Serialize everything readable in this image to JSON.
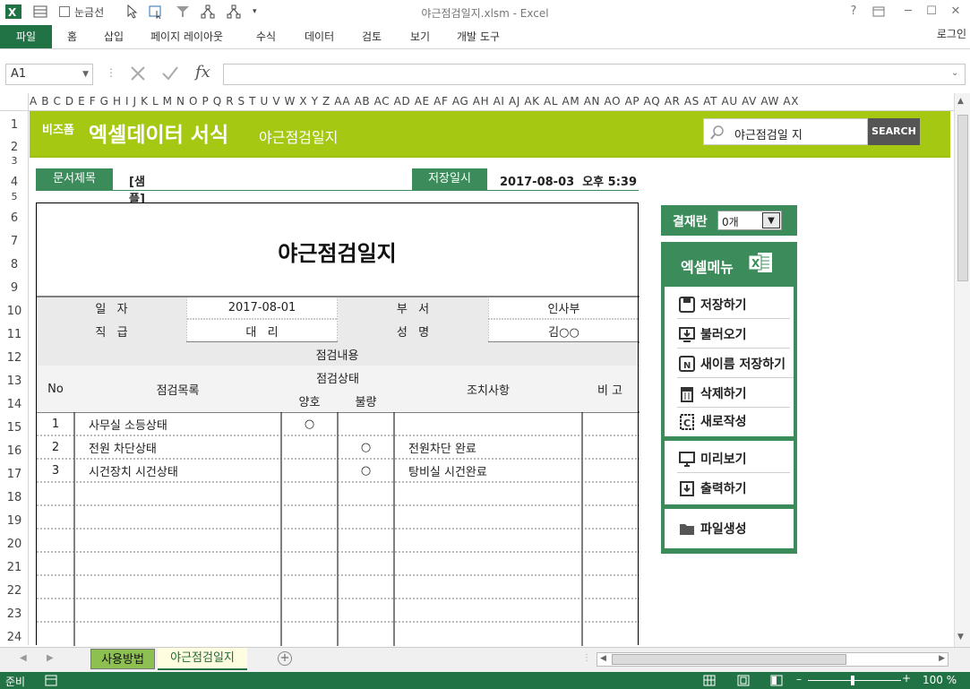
{
  "window": {
    "title": "야근점검일지.xlsm - Excel",
    "gridlines_label": "눈금선",
    "help": "?",
    "min": "─",
    "max": "☐",
    "close": "✕"
  },
  "ribbon": {
    "file": "파일",
    "tabs": [
      "홈",
      "삽입",
      "페이지 레이아웃",
      "수식",
      "데이터",
      "검토",
      "보기",
      "개발 도구"
    ],
    "login": "로그인"
  },
  "formula_bar": {
    "name_box": "A1",
    "fx": "fx",
    "value": ""
  },
  "columns": "A B C D E F G H I J K L M N O P Q R S T U V W X Y Z AA AB AC AD AE AF AG AH AI AJ AK AL AM AN AO AP AQ AR AS AT AU AV AW AX",
  "rows": [
    "1",
    "2",
    "3",
    "4",
    "5",
    "6",
    "7",
    "8",
    "9",
    "10",
    "11",
    "12",
    "13",
    "14",
    "15",
    "16",
    "17",
    "18",
    "19",
    "20",
    "21",
    "22",
    "23",
    "24"
  ],
  "banner": {
    "brand_small": "비즈폼",
    "brand_big": "엑셀데이터 서식",
    "subtitle": "야근점검일지",
    "search_value": "야근점검일 지",
    "search_button": "SEARCH"
  },
  "info": {
    "doc_title_label": "문서제목",
    "doc_title_value": "[샘플] 야근점검일지",
    "saved_label": "저장일시",
    "saved_value": "2017-08-03  오후 5:39"
  },
  "document": {
    "title": "야근점검일지",
    "date_label": "일   자",
    "date_value": "2017-08-01",
    "dept_label": "부   서",
    "dept_value": "인사부",
    "rank_label": "직   급",
    "rank_value": "대   리",
    "name_label": "성   명",
    "name_value": "김○○",
    "section_label": "점검내용",
    "col_no": "No",
    "col_item": "점검목록",
    "col_status": "점검상태",
    "col_good": "양호",
    "col_bad": "불량",
    "col_action": "조치사항",
    "col_note": "비 고",
    "rows": [
      {
        "no": "1",
        "item": "사무실 소등상태",
        "good": "○",
        "bad": "",
        "action": "",
        "note": ""
      },
      {
        "no": "2",
        "item": "전원 차단상태",
        "good": "",
        "bad": "○",
        "action": "전원차단 완료",
        "note": ""
      },
      {
        "no": "3",
        "item": "시건장치 시건상태",
        "good": "",
        "bad": "○",
        "action": "탕비실 시건완료",
        "note": ""
      }
    ]
  },
  "approval": {
    "label": "결재란",
    "select_value": "0개"
  },
  "menu": {
    "title": "엑셀메뉴",
    "group1": [
      "저장하기",
      "불러오기",
      "새이름 저장하기",
      "삭제하기",
      "새로작성"
    ],
    "group2": [
      "미리보기",
      "출력하기"
    ],
    "group3": [
      "파일생성"
    ]
  },
  "sheet_tabs": [
    "사용방법",
    "야근점검일지"
  ],
  "status": {
    "ready": "준비",
    "zoom": "100 %"
  },
  "colors": {
    "excel_green": "#217346",
    "banner_green": "#a5c812",
    "dark_green": "#3b8c5a"
  }
}
